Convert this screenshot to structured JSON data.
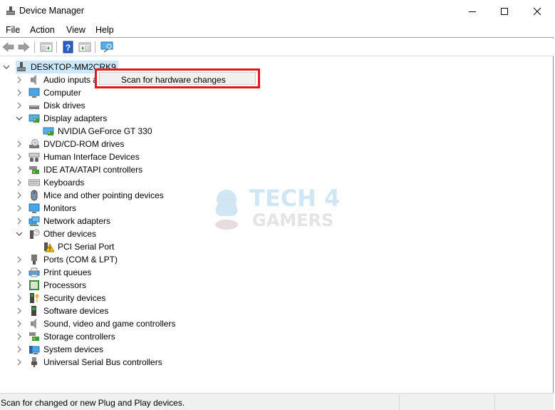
{
  "window": {
    "title": "Device Manager",
    "controls": {
      "minimize": "minimize",
      "maximize": "maximize",
      "close": "close"
    }
  },
  "menu": [
    "File",
    "Action",
    "View",
    "Help"
  ],
  "toolbar": {
    "buttons": [
      "back-arrow-icon",
      "forward-arrow-icon",
      "show-hide-console-tree-icon",
      "help-icon",
      "action-pane-icon",
      "scan-hardware-monitor-icon"
    ]
  },
  "tree": {
    "root": {
      "label": "DESKTOP-MM2CRK9",
      "expanded": true,
      "selected": true
    },
    "items": [
      {
        "label": "Audio inputs and outputs",
        "expanded": false,
        "icon": "speaker-icon"
      },
      {
        "label": "Computer",
        "expanded": false,
        "icon": "computer-icon"
      },
      {
        "label": "Disk drives",
        "expanded": false,
        "icon": "disk-drive-icon"
      },
      {
        "label": "Display adapters",
        "expanded": true,
        "icon": "display-adapter-icon",
        "children": [
          {
            "label": "NVIDIA GeForce GT 330",
            "icon": "display-adapter-icon"
          }
        ]
      },
      {
        "label": "DVD/CD-ROM drives",
        "expanded": false,
        "icon": "dvd-drive-icon"
      },
      {
        "label": "Human Interface Devices",
        "expanded": false,
        "icon": "hid-icon"
      },
      {
        "label": "IDE ATA/ATAPI controllers",
        "expanded": false,
        "icon": "ide-controller-icon"
      },
      {
        "label": "Keyboards",
        "expanded": false,
        "icon": "keyboard-icon"
      },
      {
        "label": "Mice and other pointing devices",
        "expanded": false,
        "icon": "mouse-icon"
      },
      {
        "label": "Monitors",
        "expanded": false,
        "icon": "monitor-icon"
      },
      {
        "label": "Network adapters",
        "expanded": false,
        "icon": "network-adapter-icon"
      },
      {
        "label": "Other devices",
        "expanded": true,
        "icon": "unknown-device-icon",
        "children": [
          {
            "label": "PCI Serial Port",
            "icon": "warning-device-icon"
          }
        ]
      },
      {
        "label": "Ports (COM & LPT)",
        "expanded": false,
        "icon": "port-icon"
      },
      {
        "label": "Print queues",
        "expanded": false,
        "icon": "printer-icon"
      },
      {
        "label": "Processors",
        "expanded": false,
        "icon": "processor-icon"
      },
      {
        "label": "Security devices",
        "expanded": false,
        "icon": "security-device-icon"
      },
      {
        "label": "Software devices",
        "expanded": false,
        "icon": "software-device-icon"
      },
      {
        "label": "Sound, video and game controllers",
        "expanded": false,
        "icon": "speaker-icon"
      },
      {
        "label": "Storage controllers",
        "expanded": false,
        "icon": "storage-controller-icon"
      },
      {
        "label": "System devices",
        "expanded": false,
        "icon": "system-device-icon"
      },
      {
        "label": "Universal Serial Bus controllers",
        "expanded": false,
        "icon": "usb-icon"
      }
    ]
  },
  "context_menu": {
    "items": [
      "Scan for hardware changes"
    ],
    "highlight_color": "#e1161f"
  },
  "watermark": {
    "line1": "TECH 4",
    "line2": "GAMERS"
  },
  "status": {
    "text": "Scan for changed or new Plug and Play devices."
  }
}
